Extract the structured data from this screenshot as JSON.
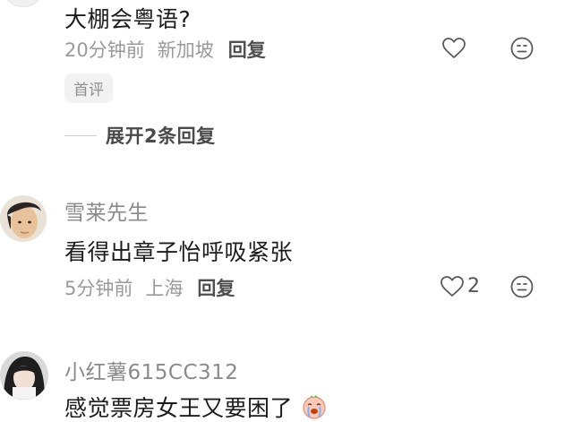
{
  "comments": [
    {
      "body": "大棚会粤语?",
      "time": "20分钟前",
      "location": "新加坡",
      "reply_label": "回复",
      "tag": "首评",
      "expand_label": "展开2条回复"
    },
    {
      "username": "雪莱先生",
      "body": "看得出章子怡呼吸紧张",
      "time": "5分钟前",
      "location": "上海",
      "reply_label": "回复",
      "like_count": "2"
    },
    {
      "username": "小红薯615CC312",
      "body": "感觉票房女王又要困了"
    }
  ],
  "icons": {
    "like": "heart-outline-icon",
    "dislike": "neutral-face-icon",
    "emoji": "crying-laughing-face-emoji"
  },
  "colors": {
    "username": "#8a8a8a",
    "body": "#1c1c1c",
    "meta": "#9a9a9a",
    "reply": "#4f4f4f",
    "tag_bg": "#f2f2f2"
  }
}
